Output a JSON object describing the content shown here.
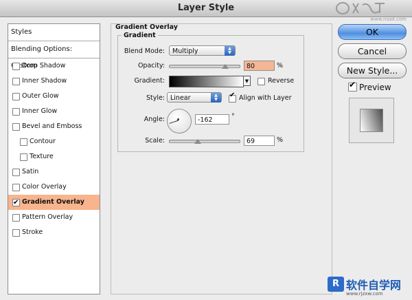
{
  "window": {
    "title": "Layer Style"
  },
  "watermarks": {
    "top": "www.nsad.com",
    "bottom_logo": "R",
    "bottom_brand": "软件自学网",
    "bottom_url": "www.rjzxw.com"
  },
  "sidebar": {
    "header": "Styles",
    "blending_options": "Blending Options: Custom",
    "items": [
      {
        "label": "Drop Shadow",
        "checked": false
      },
      {
        "label": "Inner Shadow",
        "checked": false
      },
      {
        "label": "Outer Glow",
        "checked": false
      },
      {
        "label": "Inner Glow",
        "checked": false
      },
      {
        "label": "Bevel and Emboss",
        "checked": false
      },
      {
        "label": "Contour",
        "checked": false,
        "sub": true
      },
      {
        "label": "Texture",
        "checked": false,
        "sub": true
      },
      {
        "label": "Satin",
        "checked": false
      },
      {
        "label": "Color Overlay",
        "checked": false
      },
      {
        "label": "Gradient Overlay",
        "checked": true,
        "active": true
      },
      {
        "label": "Pattern Overlay",
        "checked": false
      },
      {
        "label": "Stroke",
        "checked": false
      }
    ]
  },
  "panel": {
    "title": "Gradient Overlay",
    "group_title": "Gradient",
    "blend_mode": {
      "label": "Blend Mode:",
      "value": "Multiply"
    },
    "opacity": {
      "label": "Opacity:",
      "value": "80",
      "unit": "%",
      "level": 80
    },
    "gradient": {
      "label": "Gradient:",
      "reverse_label": "Reverse",
      "reverse_checked": false,
      "from_color": "#000000",
      "to_color": "#ffffff"
    },
    "style": {
      "label": "Style:",
      "value": "Linear",
      "align_label": "Align with Layer",
      "align_checked": true
    },
    "angle": {
      "label": "Angle:",
      "value": "-162",
      "unit": "°"
    },
    "scale": {
      "label": "Scale:",
      "value": "69",
      "unit": "%",
      "level": 69
    }
  },
  "buttons": {
    "ok": "OK",
    "cancel": "Cancel",
    "new_style": "New Style..."
  },
  "preview": {
    "label": "Preview",
    "checked": true
  },
  "colors": {
    "accent": "#f7b48d",
    "ok_button": "#4f8fe0"
  }
}
